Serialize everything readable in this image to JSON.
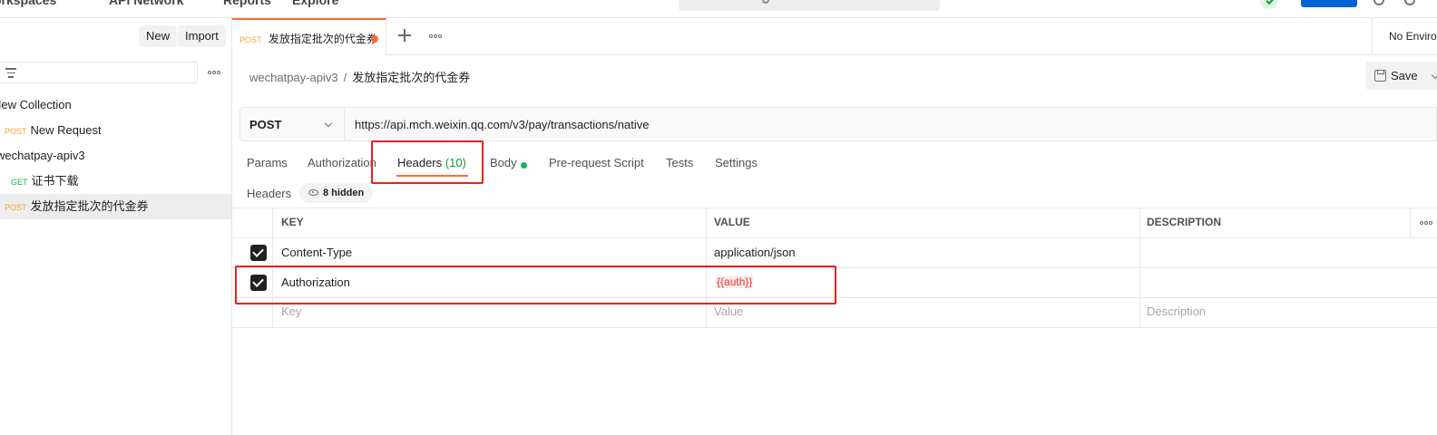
{
  "topbar": {
    "nav_items": [
      "Workspaces",
      "API Network",
      "Reports",
      "Explore"
    ]
  },
  "sidebar": {
    "new_label": "New",
    "import_label": "Import",
    "tree": [
      {
        "label": "New Collection",
        "method": ""
      },
      {
        "label": "New Request",
        "method": "POST"
      },
      {
        "label": "wechatpay-apiv3",
        "method": ""
      },
      {
        "label": "证书下载",
        "method": "GET"
      },
      {
        "label": "发放指定批次的代金券",
        "method": "POST",
        "selected": true
      }
    ]
  },
  "tab": {
    "method": "POST",
    "title": "发放指定批次的代金券",
    "environment": "No Environment"
  },
  "breadcrumb": {
    "parent": "wechatpay-apiv3",
    "separator": "/",
    "current": "发放指定批次的代金券"
  },
  "save_label": "Save",
  "request": {
    "method": "POST",
    "url": "https://api.mch.weixin.qq.com/v3/pay/transactions/native"
  },
  "subtabs": {
    "params": "Params",
    "authorization": "Authorization",
    "headers": "Headers",
    "headers_count": "(10)",
    "body": "Body",
    "prerequest": "Pre-request Script",
    "tests": "Tests",
    "settings": "Settings"
  },
  "headers_section": {
    "label": "Headers",
    "hidden_badge": "8 hidden"
  },
  "table": {
    "columns": [
      "KEY",
      "VALUE",
      "DESCRIPTION"
    ],
    "rows": [
      {
        "checked": true,
        "key": "Content-Type",
        "value": "application/json",
        "description": ""
      },
      {
        "checked": true,
        "key": "Authorization",
        "value": "{{auth}}",
        "description": ""
      }
    ],
    "placeholders": {
      "key": "Key",
      "value": "Value",
      "description": "Description"
    }
  },
  "colors": {
    "accent": "#ff6c37",
    "post": "#f0a52f",
    "get": "#0cbb52",
    "highlight": "#e8221c",
    "variable": "#e5342b"
  }
}
